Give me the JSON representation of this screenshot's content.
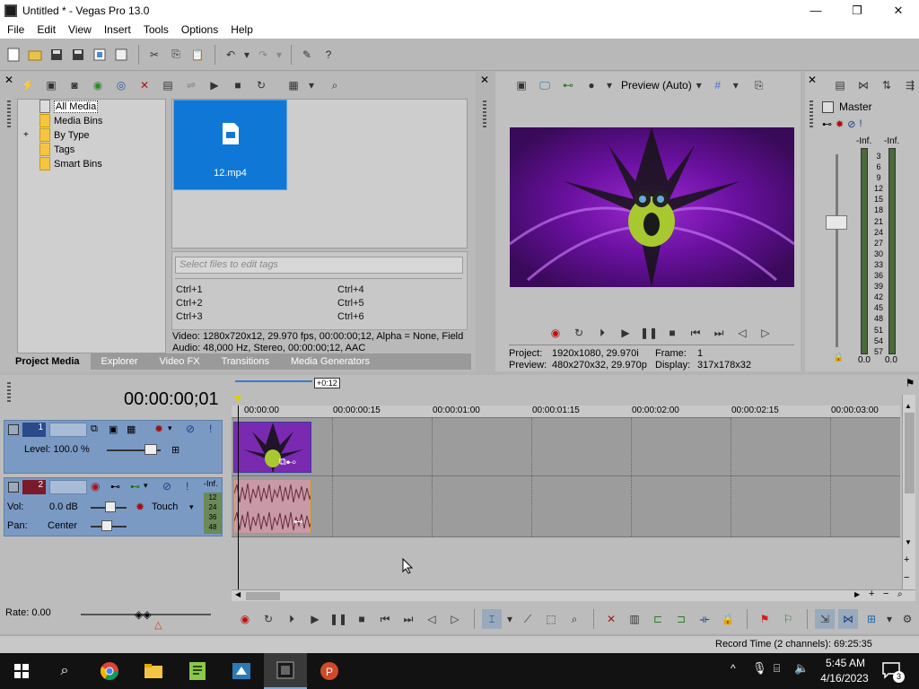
{
  "window": {
    "title": "Untitled * - Vegas Pro 13.0",
    "controls": [
      "—",
      "❐",
      "✕"
    ]
  },
  "menu": [
    "File",
    "Edit",
    "View",
    "Insert",
    "Tools",
    "Options",
    "Help"
  ],
  "explorer": {
    "tree": [
      "All Media",
      "Media Bins",
      "By Type",
      "Tags",
      "Smart Bins"
    ],
    "expander": "+",
    "media_file": "12.mp4",
    "tag_placeholder": "Select files to edit tags",
    "hotkeys_left": [
      "Ctrl+1",
      "Ctrl+2",
      "Ctrl+3"
    ],
    "hotkeys_right": [
      "Ctrl+4",
      "Ctrl+5",
      "Ctrl+6"
    ],
    "video_info": "Video: 1280x720x12, 29.970 fps, 00:00:00;12, Alpha = None, Field",
    "audio_info": "Audio: 48,000 Hz, Stereo, 00:00:00;12, AAC"
  },
  "tabs": [
    "Project Media",
    "Explorer",
    "Video FX",
    "Transitions",
    "Media Generators"
  ],
  "preview": {
    "mode": "Preview (Auto)",
    "project_label": "Project:",
    "project_value": "1920x1080, 29.970i",
    "preview_label": "Preview:",
    "preview_value": "480x270x32, 29.970p",
    "frame_label": "Frame:",
    "frame_value": "1",
    "display_label": "Display:",
    "display_value": "317x178x32"
  },
  "master": {
    "label": "Master",
    "inf_left": "-Inf.",
    "inf_right": "-Inf.",
    "scale": [
      "3",
      "6",
      "9",
      "12",
      "15",
      "18",
      "21",
      "24",
      "27",
      "30",
      "33",
      "36",
      "39",
      "42",
      "45",
      "48",
      "51",
      "54",
      "57"
    ],
    "bottom_left": "0.0",
    "bottom_right": "0.0"
  },
  "timeline": {
    "timecode": "00:00:00;01",
    "loop_marker": "+0:12",
    "ruler": [
      "00:00:00",
      "00:00:00:15",
      "00:00:01:00",
      "00:00:01:15",
      "00:00:02:00",
      "00:00:02:15",
      "00:00:03:00"
    ],
    "video_track": {
      "number": "1",
      "level": "Level: 100.0 %"
    },
    "audio_track": {
      "number": "2",
      "vol_label": "Vol:",
      "vol_value": "0.0 dB",
      "pan_label": "Pan:",
      "pan_value": "Center",
      "automation": "Touch",
      "meter_top": "-Inf.",
      "meter_scale": [
        "12",
        "24",
        "36",
        "48"
      ]
    }
  },
  "rate": "Rate: 0.00",
  "status": "Record Time (2 channels): 69:25:35",
  "taskbar": {
    "time": "5:45 AM",
    "date": "4/16/2023",
    "notification_count": "3"
  },
  "colors": {
    "media_selected": "#0f78d7",
    "track_header": "#7a9ac4",
    "preview_purple": "#5a1a7a"
  }
}
